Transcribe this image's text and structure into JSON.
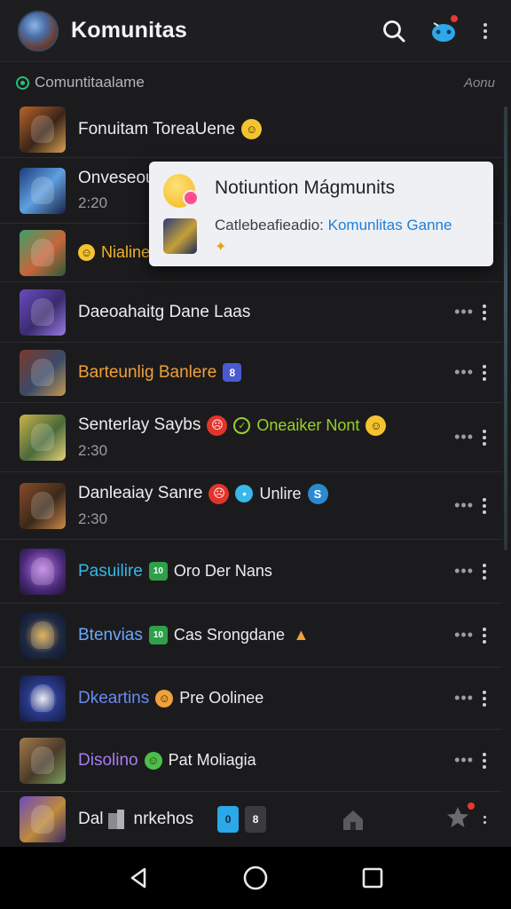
{
  "app": {
    "title": "Komunitas"
  },
  "section": {
    "label": "Comuntitaalame",
    "right": "Aonu"
  },
  "popup": {
    "title": "Notiuntion Mágmunits",
    "body_prefix": "Catlebeafieadio:",
    "body_link": "Komunlitas Ganne"
  },
  "rows": [
    {
      "title": "Fonuitam ToreaUene",
      "sub": ""
    },
    {
      "title": "Onveseou",
      "sub": "2:20"
    },
    {
      "title": "Nialine",
      "sub": ""
    },
    {
      "title": "Daeoahaitg Dane Laas",
      "sub": ""
    },
    {
      "title": "Barteunlig Banlere",
      "sub": "",
      "badge": "8"
    },
    {
      "title": "Senterlay Saybs",
      "tag": "Oneaiker Nont",
      "sub": "2:30"
    },
    {
      "title": "Danleaiay Sanre",
      "tag": "Unlire",
      "sub": "2:30"
    },
    {
      "title": "Pasuilire",
      "badge": "10",
      "tag": "Oro Der Nans",
      "sub": ""
    },
    {
      "title": "Btenvias",
      "badge": "10",
      "tag": "Cas Srongdane",
      "sub": ""
    },
    {
      "title": "Dkeartins",
      "tag": "Pre Oolinee",
      "sub": ""
    },
    {
      "title": "Disolino",
      "tag": "Pat Moliagia",
      "sub": ""
    },
    {
      "title": "Dal",
      "tag": "nrkehos",
      "badges": [
        "0",
        "8"
      ],
      "sub": ""
    }
  ],
  "colors": {
    "accent_green": "#27c07a",
    "accent_orange": "#f0a13a",
    "accent_cyan": "#36b8e8",
    "accent_blue": "#6aa8ff",
    "accent_purple": "#a77cf2",
    "notification_red": "#e53935"
  }
}
